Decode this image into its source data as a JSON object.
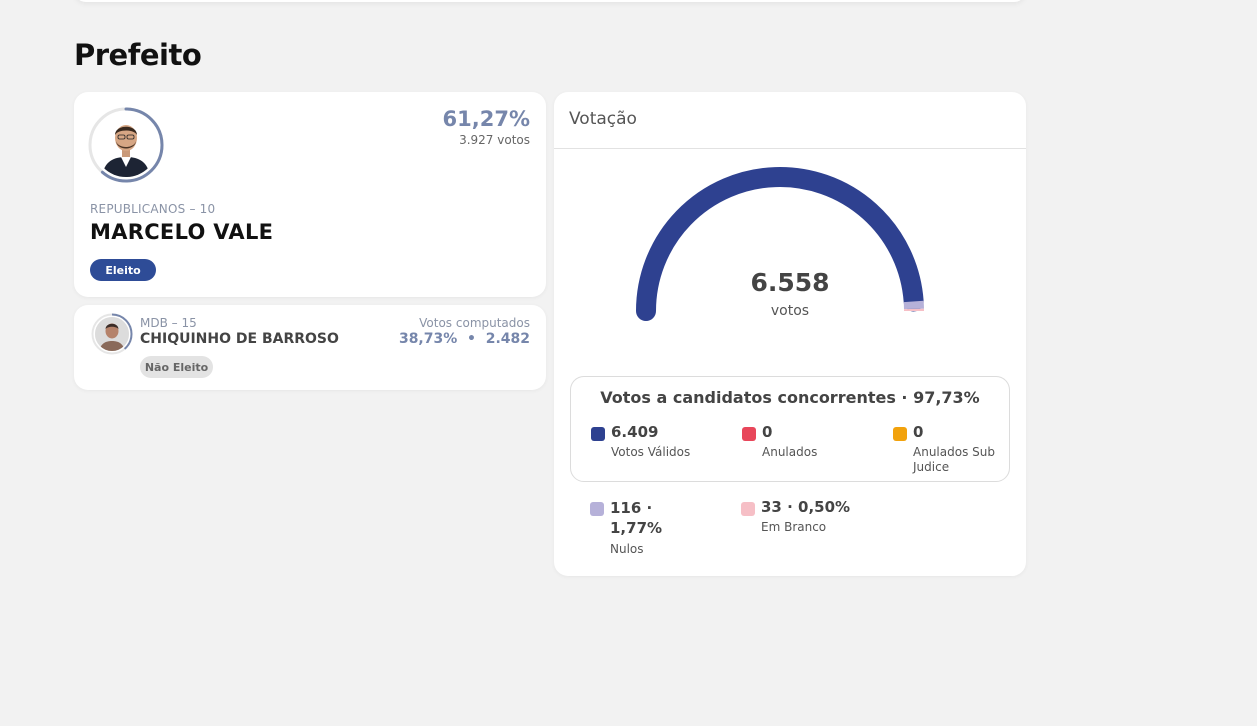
{
  "page_title": "Prefeito",
  "winner": {
    "percent": "61,27%",
    "votes": "3.927 votos",
    "party": "REPUBLICANOS – 10",
    "name": "MARCELO VALE",
    "status": "Eleito",
    "share": 0.6127
  },
  "runner_up": {
    "party": "MDB – 15",
    "name": "CHIQUINHO DE BARROSO",
    "computed_label": "Votos computados",
    "computed_value": "38,73%  •  2.482",
    "status": "Não Eleito",
    "share": 0.3873
  },
  "votacao": {
    "title": "Votação",
    "total": "6.558",
    "unit": "votos",
    "gauge": {
      "valid_fraction": 0.9773,
      "null_fraction": 0.0177,
      "blank_fraction": 0.005
    },
    "concorrentes_title": "Votos a candidatos concorrentes · 97,73%",
    "items": [
      {
        "value": "6.409",
        "label": "Votos Válidos",
        "color": "#2e4190"
      },
      {
        "value": "0",
        "label": "Anulados",
        "color": "#e8465a"
      },
      {
        "value": "0",
        "label": "Anulados Sub Judice",
        "color": "#f2a20c"
      }
    ],
    "others": [
      {
        "value": "116 · 1,77%",
        "label": "Nulos",
        "color": "#b6b1d9"
      },
      {
        "value": "33 · 0,50%",
        "label": "Em Branco",
        "color": "#f6bfc6"
      }
    ]
  }
}
